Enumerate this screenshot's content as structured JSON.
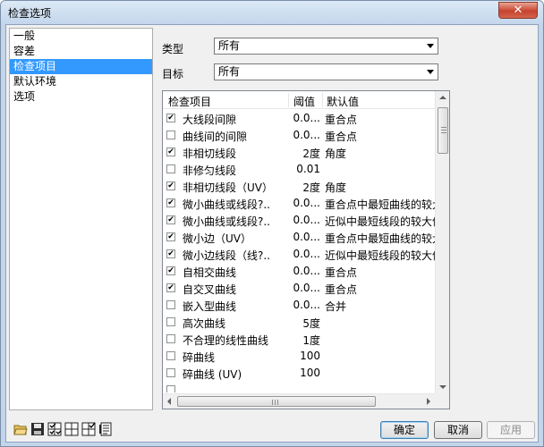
{
  "window": {
    "title": "检查选项",
    "close_glyph": "✕"
  },
  "categories": [
    {
      "label": "一般",
      "selected": false
    },
    {
      "label": "容差",
      "selected": false
    },
    {
      "label": "检查项目",
      "selected": true
    },
    {
      "label": "默认环境",
      "selected": false
    },
    {
      "label": "选项",
      "selected": false
    }
  ],
  "filters": {
    "type_label": "类型",
    "type_value": "所有",
    "target_label": "目标",
    "target_value": "所有"
  },
  "table": {
    "columns": [
      "检查项目",
      "阈值",
      "默认值"
    ],
    "rows": [
      {
        "checked": true,
        "name": "大线段间隙",
        "threshold": "0.0...",
        "default": "重合点"
      },
      {
        "checked": false,
        "name": "曲线间的间隙",
        "threshold": "0.0...",
        "default": "重合点"
      },
      {
        "checked": true,
        "name": "非相切线段",
        "threshold": "2度",
        "default": "角度"
      },
      {
        "checked": false,
        "name": "非修匀线段",
        "threshold": "0.01",
        "default": ""
      },
      {
        "checked": true,
        "name": "非相切线段（UV）",
        "threshold": "2度",
        "default": "角度"
      },
      {
        "checked": true,
        "name": "微小曲线或线段?..",
        "threshold": "0.0...",
        "default": "重合点中最短曲线的较大"
      },
      {
        "checked": true,
        "name": "微小曲线或线段?..",
        "threshold": "0.0...",
        "default": "近似中最短线段的较大值"
      },
      {
        "checked": true,
        "name": "微小边（UV）",
        "threshold": "0.0...",
        "default": "重合点中最短曲线的较大"
      },
      {
        "checked": true,
        "name": "微小边线段（线?..",
        "threshold": "0.0...",
        "default": "近似中最短线段的较大值"
      },
      {
        "checked": true,
        "name": "自相交曲线",
        "threshold": "0.0...",
        "default": "重合点"
      },
      {
        "checked": true,
        "name": "自交叉曲线",
        "threshold": "0.0...",
        "default": "重合点"
      },
      {
        "checked": false,
        "name": "嵌入型曲线",
        "threshold": "0.0...",
        "default": "合并"
      },
      {
        "checked": false,
        "name": "高次曲线",
        "threshold": "5度",
        "default": ""
      },
      {
        "checked": false,
        "name": "不合理的线性曲线",
        "threshold": "1度",
        "default": ""
      },
      {
        "checked": false,
        "name": "碎曲线",
        "threshold": "100",
        "default": ""
      },
      {
        "checked": false,
        "name": "碎曲线 (UV)",
        "threshold": "100",
        "default": ""
      },
      {
        "checked": false,
        "name": "",
        "threshold": "",
        "default": ""
      }
    ]
  },
  "toolbar": {
    "icons": [
      "open-folder-icon",
      "save-icon",
      "select-all-grid-icon",
      "grid-icon",
      "check-grid-icon",
      "document-icon"
    ]
  },
  "buttons": {
    "ok": "确定",
    "cancel": "取消",
    "apply": "应用"
  },
  "colors": {
    "selection": "#3399ff",
    "title_bar": "#c3d6ec",
    "close_button": "#c7432e"
  }
}
